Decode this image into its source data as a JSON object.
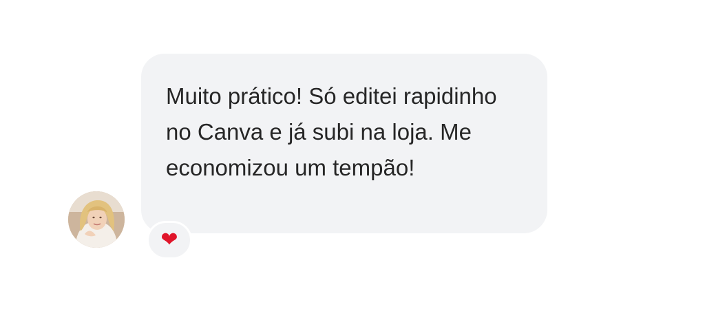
{
  "message": {
    "text": "Muito prático! Só editei rapidinho no Canva e já subi na loja. Me economizou um tempão!"
  },
  "reaction": {
    "icon": "heart-icon",
    "glyph": "❤",
    "color": "#e0152a"
  },
  "colors": {
    "bubble_background": "#f2f3f5",
    "text": "#262626",
    "page_background": "#ffffff"
  }
}
